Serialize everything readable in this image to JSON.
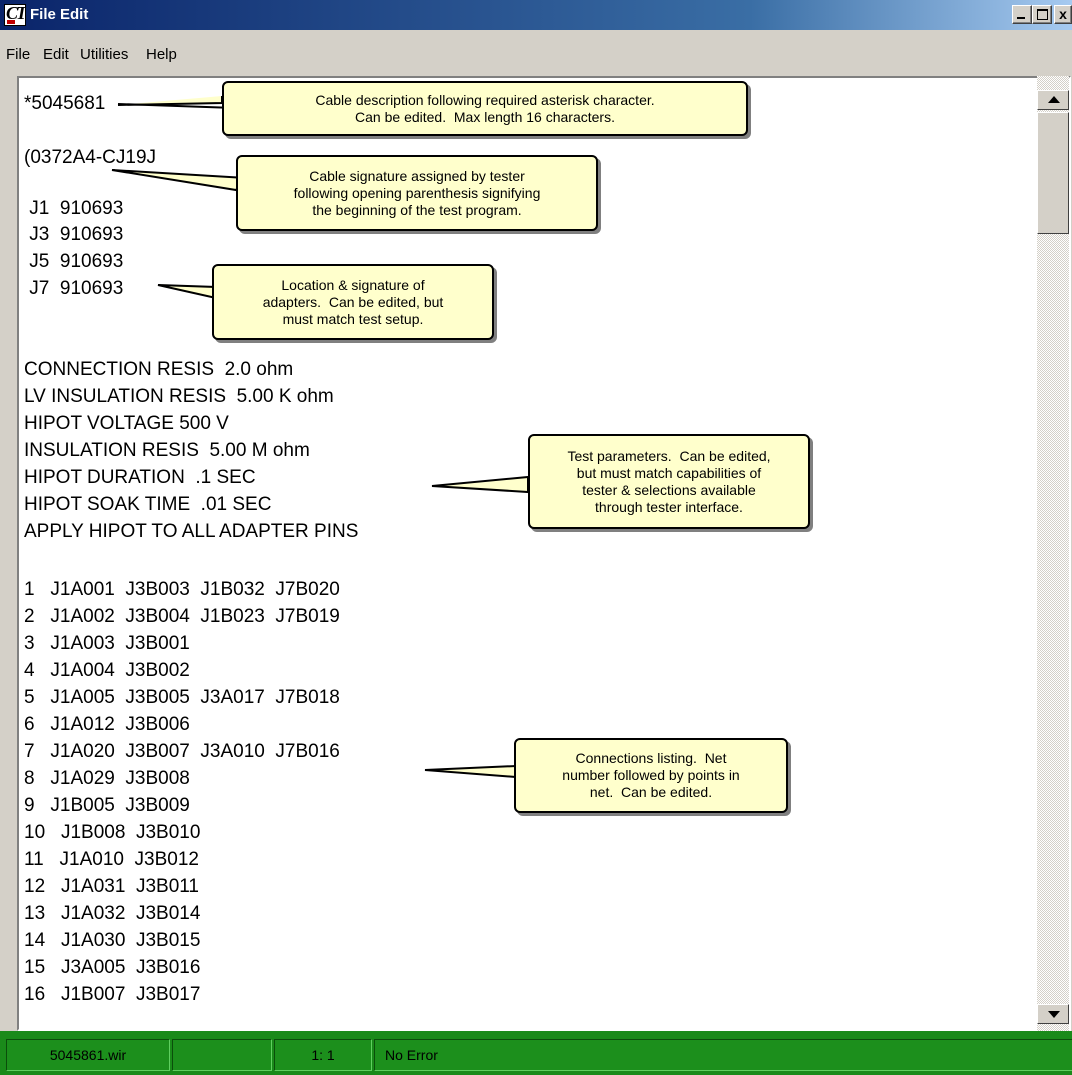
{
  "window": {
    "title": "File Edit",
    "controls": {
      "minimize": "_",
      "maximize": "□",
      "close": "x"
    }
  },
  "menu": [
    "File",
    "Edit",
    "Utilities",
    "Help"
  ],
  "editor": {
    "lines": [
      "*5045681",
      "",
      "(0372A4-CJ19J",
      "",
      " J1  910693",
      " J3  910693",
      " J5  910693",
      " J7  910693",
      "",
      "",
      "CONNECTION RESIS  2.0 ohm",
      "LV INSULATION RESIS  5.00 K ohm",
      "HIPOT VOLTAGE 500 V",
      "INSULATION RESIS  5.00 M ohm",
      "HIPOT DURATION  .1 SEC",
      "HIPOT SOAK TIME  .01 SEC",
      "APPLY HIPOT TO ALL ADAPTER PINS",
      "",
      "1   J1A001  J3B003  J1B032  J7B020",
      "2   J1A002  J3B004  J1B023  J7B019",
      "3   J1A003  J3B001",
      "4   J1A004  J3B002",
      "5   J1A005  J3B005  J3A017  J7B018",
      "6   J1A012  J3B006",
      "7   J1A020  J3B007  J3A010  J7B016",
      "8   J1A029  J3B008",
      "9   J1B005  J3B009",
      "10   J1B008  J3B010",
      "11   J1A010  J3B012",
      "12   J1A031  J3B011",
      "13   J1A032  J3B014",
      "14   J1A030  J3B015",
      "15   J3A005  J3B016",
      "16   J1B007  J3B017"
    ]
  },
  "callouts": {
    "description": "Cable description following required asterisk character.\nCan be edited.  Max length 16 characters.",
    "signature": "Cable signature assigned by tester\nfollowing opening parenthesis signifying\nthe beginning of the test program.",
    "adapters": "Location & signature of\nadapters.  Can be edited, but\nmust match test setup.",
    "parameters": "Test parameters.  Can be edited,\nbut must match capabilities of\ntester & selections available\nthrough tester interface.",
    "connections": "Connections listing.  Net\nnumber followed by points in\nnet.  Can be edited."
  },
  "status": {
    "file": "5045861.wir",
    "blank": "",
    "position": "1: 1",
    "message": "No Error"
  },
  "colors": {
    "title_gradient_start": "#0a246a",
    "callout_fill": "#ffffcc",
    "status_green": "#1a8a1a"
  }
}
